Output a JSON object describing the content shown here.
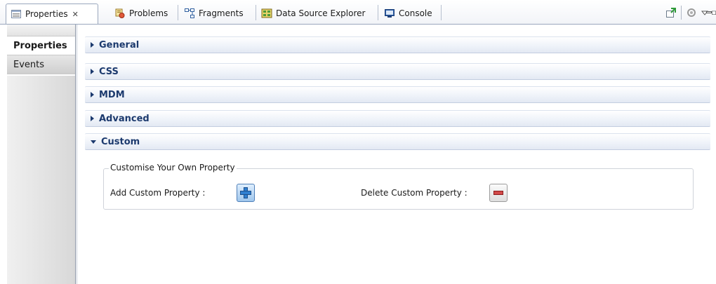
{
  "tabs": [
    {
      "label": "Properties",
      "icon": "properties-icon",
      "active": true,
      "close": "✕"
    },
    {
      "label": "Problems",
      "icon": "problems-icon"
    },
    {
      "label": "Fragments",
      "icon": "fragments-icon"
    },
    {
      "label": "Data Source Explorer",
      "icon": "data-source-explorer-icon"
    },
    {
      "label": "Console",
      "icon": "console-icon"
    }
  ],
  "toolbar": {
    "icons": [
      "pin-editor-icon",
      "synchronize-icon",
      "view-menu-icon",
      "minimize-icon",
      "maximize-icon"
    ]
  },
  "left_tabs": [
    {
      "label": "Properties",
      "selected": true
    },
    {
      "label": "Events",
      "selected": false
    }
  ],
  "sections": [
    {
      "label": "General",
      "expanded": false
    },
    {
      "label": "CSS",
      "expanded": false
    },
    {
      "label": "MDM",
      "expanded": false
    },
    {
      "label": "Advanced",
      "expanded": false
    },
    {
      "label": "Custom",
      "expanded": true
    }
  ],
  "custom": {
    "group_title": "Customise Your Own Property",
    "add_label": "Add Custom Property :",
    "delete_label": "Delete Custom Property :",
    "add_icon": "add-icon",
    "delete_icon": "remove-icon"
  },
  "colors": {
    "section_text": "#1c3a6e",
    "tab_border": "#9aa7bd",
    "add_button": "#2f7fd0",
    "delete_button": "#d24a4a"
  }
}
